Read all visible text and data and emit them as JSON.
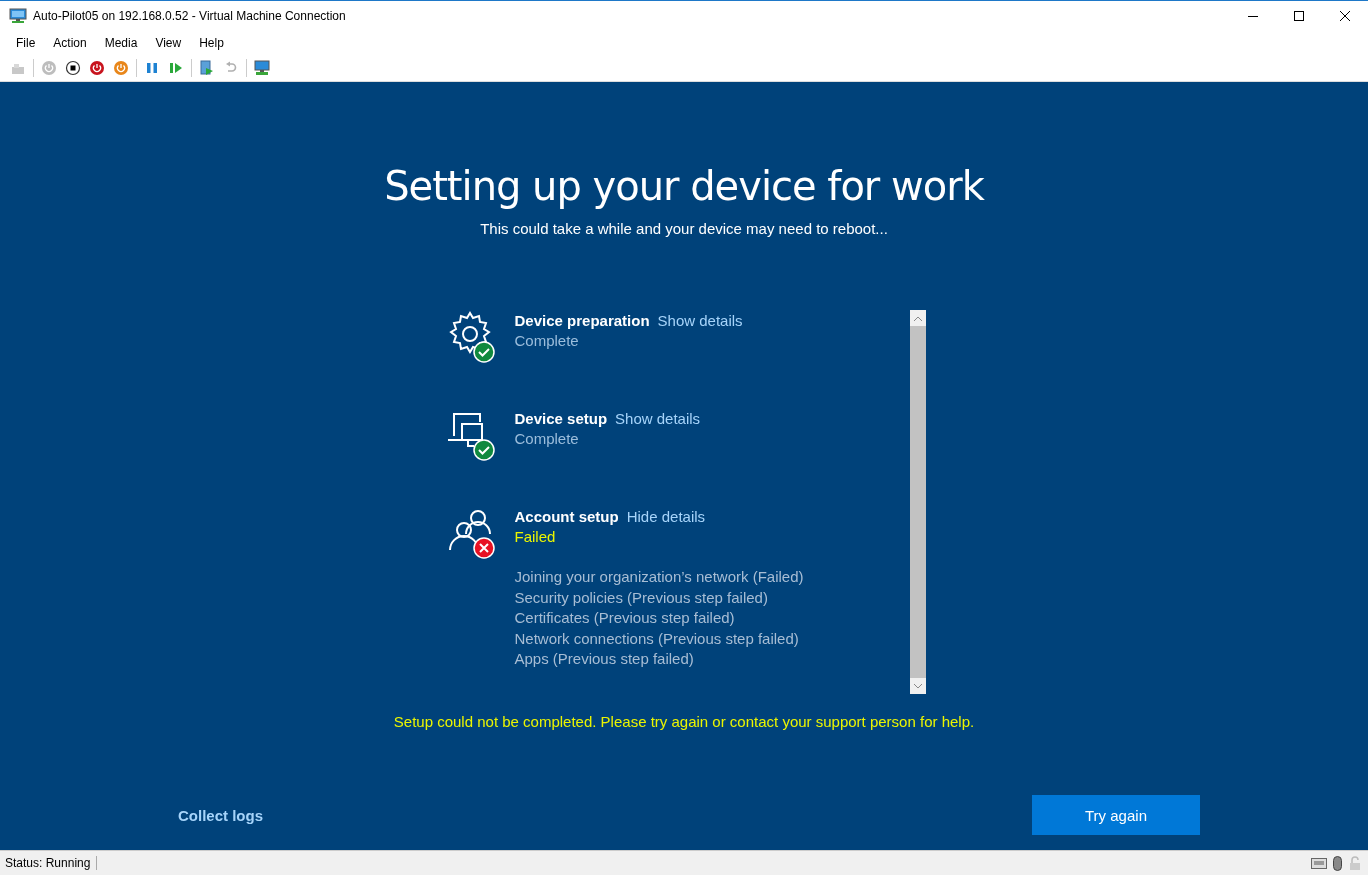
{
  "window": {
    "title": "Auto-Pilot05 on 192.168.0.52 - Virtual Machine Connection"
  },
  "menu": [
    "File",
    "Action",
    "Media",
    "View",
    "Help"
  ],
  "toolbar": [
    {
      "kind": "ctrl-alt-del",
      "disabled": true
    },
    {
      "kind": "start",
      "disabled": true
    },
    {
      "kind": "turn-off",
      "disabled": false
    },
    {
      "kind": "shut-down",
      "disabled": false
    },
    {
      "kind": "save",
      "disabled": false
    },
    {
      "kind": "pause",
      "disabled": false
    },
    {
      "kind": "reset",
      "disabled": false
    },
    {
      "kind": "checkpoint",
      "disabled": false
    },
    {
      "kind": "revert",
      "disabled": true
    },
    {
      "kind": "enhanced-session",
      "disabled": false
    }
  ],
  "page": {
    "title": "Setting up your device for work",
    "subtitle": "This could take a while and your device may need to reboot...",
    "sections": [
      {
        "kind": "device-preparation",
        "title": "Device preparation",
        "link": "Show details",
        "failed": false,
        "status_text": "Complete"
      },
      {
        "kind": "device-setup",
        "title": "Device setup",
        "link": "Show details",
        "failed": false,
        "status_text": "Complete"
      },
      {
        "kind": "account-setup",
        "title": "Account setup",
        "link": "Hide details",
        "failed": true,
        "status_text": "Failed",
        "details": [
          "Joining your organization’s network (Failed)",
          "Security policies (Previous step failed)",
          "Certificates (Previous step failed)",
          "Network connections (Previous step failed)",
          "Apps (Previous step failed)"
        ]
      }
    ],
    "error": "Setup could not be completed. Please try again or contact your support person for help.",
    "collect_logs": "Collect logs",
    "try_again": "Try again"
  },
  "status_bar": {
    "text": "Status: Running"
  }
}
